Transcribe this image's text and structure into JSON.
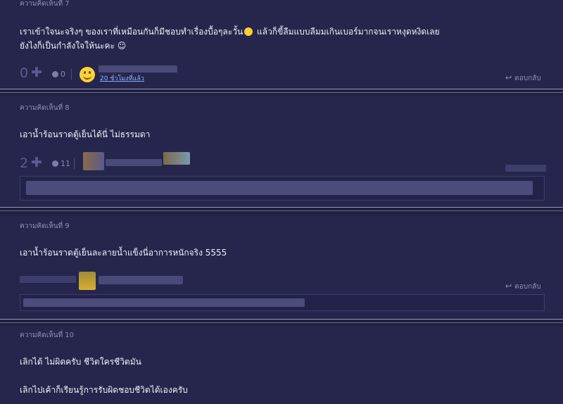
{
  "comments": [
    {
      "label": "ความคิดเห็นที่ 7",
      "line1_a": "เราเข้าใจนะจริงๆ ของเราที่เหมือนกันก็มีชอบทำเรื่องบื้อๆละวั้น",
      "line1_b": "แล้วก็ขี้ลืมแบบลืมมเกินเบอร์มากจนเราหงุดหงิดเลย",
      "line2": "ยังไงก็เป็นกำลังใจให้นะคะ ☺",
      "votes": "0",
      "emotions": "0",
      "time": "20 ชั่วโมงที่แล้ว",
      "reply": "ตอบกลับ"
    },
    {
      "label": "ความคิดเห็นที่ 8",
      "text": "เอาน้ำร้อนราดตู้เย็นได้นี่ ไม่ธรรมดา",
      "votes": "2",
      "emotions": "11"
    },
    {
      "label": "ความคิดเห็นที่ 9",
      "text": "เอาน้ำร้อนราดตู้เย็นละลายน้ำแข็งนี่อาการหนักจริง 5555",
      "reply": "ตอบกลับ"
    },
    {
      "label": "ความคิดเห็นที่ 10",
      "line1": "เลิกได้ ไม่ผิดครับ ชีวิตใครชีวิตมัน",
      "line2": "เลิกไปเค้าก็เรียนรู้การรับผิดชอบชีวิตได้เองครับ"
    }
  ],
  "icons": {
    "plus": "plus-icon",
    "emotion": "emotion-face-icon",
    "reply": "reply-arrow-icon",
    "avatar": "smiley-avatar-icon"
  },
  "colors": {
    "background": "#1f1f3f",
    "card": "#26264d",
    "link": "#8fb0ff"
  }
}
